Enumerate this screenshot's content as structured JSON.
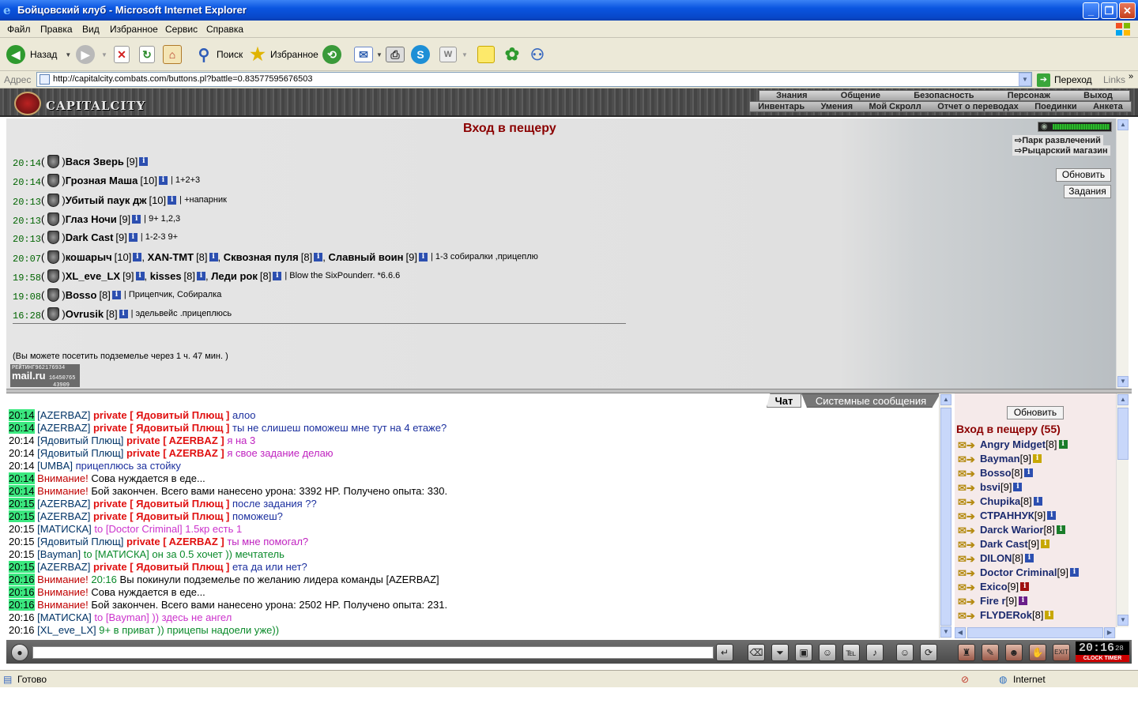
{
  "window": {
    "title": "Бойцовский клуб - Microsoft Internet Explorer",
    "minimize": "_",
    "maximize": "❐",
    "close": "✕"
  },
  "menu": [
    "Файл",
    "Правка",
    "Вид",
    "Избранное",
    "Сервис",
    "Справка"
  ],
  "toolbar": {
    "back": "Назад",
    "search": "Поиск",
    "favorites": "Избранное"
  },
  "address": {
    "label": "Адрес",
    "url": "http://capitalcity.combats.com/buttons.pl?battle=0.83577595676503",
    "go": "Переход",
    "links": "Links"
  },
  "game": {
    "logo": "CAPITALCITY",
    "nav_top": [
      "Знания",
      "Общение",
      "Безопасность",
      "Персонаж",
      "Выход"
    ],
    "nav_bottom": [
      "Инвентарь",
      "Умения",
      "Мой Скролл",
      "Отчет о переводах",
      "Поединки",
      "Анкета"
    ]
  },
  "cave": {
    "title": "Вход в пещеру",
    "rows": [
      {
        "time": "20:14",
        "members": [
          {
            "nick": "Вася Зверь",
            "level": "[9]"
          }
        ],
        "note": ""
      },
      {
        "time": "20:14",
        "members": [
          {
            "nick": "Грозная Маша",
            "level": "[10]"
          }
        ],
        "note": "| 1+2+3"
      },
      {
        "time": "20:13",
        "members": [
          {
            "nick": "Убитый паук дж",
            "level": "[10]"
          }
        ],
        "note": "| +напарник"
      },
      {
        "time": "20:13",
        "members": [
          {
            "nick": "Глаз Ночи",
            "level": "[9]"
          }
        ],
        "note": "| 9+ 1,2,3"
      },
      {
        "time": "20:13",
        "members": [
          {
            "nick": "Dark Cast",
            "level": "[9]"
          }
        ],
        "note": "| 1-2-3 9+"
      },
      {
        "time": "20:07",
        "members": [
          {
            "nick": "кошарыч",
            "level": "[10]"
          },
          {
            "nick": "XAN-TMT",
            "level": "[8]"
          },
          {
            "nick": "Сквозная пуля",
            "level": "[8]"
          },
          {
            "nick": "Славный воин",
            "level": "[9]"
          }
        ],
        "note": "| 1-3 собиралки ,прицеплю"
      },
      {
        "time": "19:58",
        "members": [
          {
            "nick": "XL_eve_LX",
            "level": "[9]"
          },
          {
            "nick": "kisses",
            "level": "[8]"
          },
          {
            "nick": "Леди рок",
            "level": "[8]"
          }
        ],
        "note": "| Blow the SixPounderr. *6.6.6"
      },
      {
        "time": "19:08",
        "members": [
          {
            "nick": "Bosso",
            "level": "[8]"
          }
        ],
        "note": "| Прицепчик, Собиралка"
      },
      {
        "time": "16:28",
        "members": [
          {
            "nick": "Ovrusik",
            "level": "[8]"
          }
        ],
        "note": "| эдельвейс .прицеплюсь"
      }
    ],
    "message": "(Вы можете посетить подземелье через 1 ч. 47 мин. )",
    "counter": {
      "label": "РЕЙТИНГ",
      "v1": "962176934",
      "v2": "16450765",
      "v3": "43909",
      "brand": "mail.ru"
    },
    "links": [
      "Парк развлечений",
      "Рыцарский магазин"
    ],
    "refresh": "Обновить",
    "tasks": "Задания"
  },
  "chat": {
    "tabs": [
      "Чат",
      "Системные сообщения"
    ],
    "lines": [
      {
        "time": "20:14",
        "hl": true,
        "parts": [
          {
            "c": "nk",
            "t": "[AZERBAZ]"
          },
          {
            "c": "priv",
            "t": "private [ Ядовитый Плющ ]"
          },
          {
            "c": "mblue",
            "t": "алоо"
          }
        ]
      },
      {
        "time": "20:14",
        "hl": true,
        "parts": [
          {
            "c": "nk",
            "t": "[AZERBAZ]"
          },
          {
            "c": "priv",
            "t": "private [ Ядовитый Плющ ]"
          },
          {
            "c": "mblue",
            "t": "ты не слишеш поможеш мне тут на 4 етаже?"
          }
        ]
      },
      {
        "time": "20:14",
        "hl": false,
        "parts": [
          {
            "c": "nk",
            "t": "[Ядовитый Плющ]"
          },
          {
            "c": "priv",
            "t": "private [ AZERBAZ ]"
          },
          {
            "c": "mpurple",
            "t": "я на 3"
          }
        ]
      },
      {
        "time": "20:14",
        "hl": false,
        "parts": [
          {
            "c": "nk",
            "t": "[Ядовитый Плющ]"
          },
          {
            "c": "priv",
            "t": "private [ AZERBAZ ]"
          },
          {
            "c": "mpurple",
            "t": "я свое задание делаю"
          }
        ]
      },
      {
        "time": "20:14",
        "hl": false,
        "parts": [
          {
            "c": "nk",
            "t": "[UMBA]"
          },
          {
            "c": "mblue",
            "t": "прицеплюсь за стойку"
          }
        ]
      },
      {
        "time": "20:14",
        "hl": true,
        "parts": [
          {
            "c": "warn",
            "t": "Внимание!"
          },
          {
            "c": "mblack",
            "t": "Сова нуждается в еде..."
          }
        ]
      },
      {
        "time": "20:14",
        "hl": true,
        "parts": [
          {
            "c": "warn",
            "t": "Внимание!"
          },
          {
            "c": "mblack",
            "t": "Бой закончен. Всего вами нанесено урона: 3392 HP. Получено опыта: 330."
          }
        ]
      },
      {
        "time": "20:15",
        "hl": true,
        "parts": [
          {
            "c": "nk",
            "t": "[AZERBAZ]"
          },
          {
            "c": "priv",
            "t": "private [ Ядовитый Плющ ]"
          },
          {
            "c": "mblue",
            "t": "после задания ??"
          }
        ]
      },
      {
        "time": "20:15",
        "hl": true,
        "parts": [
          {
            "c": "nk",
            "t": "[AZERBAZ]"
          },
          {
            "c": "priv",
            "t": "private [ Ядовитый Плющ ]"
          },
          {
            "c": "mblue",
            "t": "поможеш?"
          }
        ]
      },
      {
        "time": "20:15",
        "hl": false,
        "parts": [
          {
            "c": "nk",
            "t": "[МАТИСКА]"
          },
          {
            "c": "magenta",
            "t": "to [Doctor Criminal] 1.5кр есть 1"
          }
        ]
      },
      {
        "time": "20:15",
        "hl": false,
        "parts": [
          {
            "c": "nk",
            "t": "[Ядовитый Плющ]"
          },
          {
            "c": "priv",
            "t": "private [ AZERBAZ ]"
          },
          {
            "c": "mpurple",
            "t": "ты мне помогал?"
          }
        ]
      },
      {
        "time": "20:15",
        "hl": false,
        "parts": [
          {
            "c": "nk",
            "t": "[Bayman]"
          },
          {
            "c": "mgreen",
            "t": "to [МАТИСКА] он за 0.5 хочет )) мечтатель"
          }
        ]
      },
      {
        "time": "20:15",
        "hl": true,
        "parts": [
          {
            "c": "nk",
            "t": "[AZERBAZ]"
          },
          {
            "c": "priv",
            "t": "private [ Ядовитый Плющ ]"
          },
          {
            "c": "mblue",
            "t": "ета да или нет?"
          }
        ]
      },
      {
        "time": "20:16",
        "hl": true,
        "parts": [
          {
            "c": "warn",
            "t": "Внимание!"
          },
          {
            "c": "mgreen",
            "t": "20:16"
          },
          {
            "c": "mblack",
            "t": "Вы покинули подземелье по желанию лидера команды [AZERBAZ]"
          }
        ]
      },
      {
        "time": "20:16",
        "hl": true,
        "parts": [
          {
            "c": "warn",
            "t": "Внимание!"
          },
          {
            "c": "mblack",
            "t": "Сова нуждается в еде..."
          }
        ]
      },
      {
        "time": "20:16",
        "hl": true,
        "parts": [
          {
            "c": "warn",
            "t": "Внимание!"
          },
          {
            "c": "mblack",
            "t": "Бой закончен. Всего вами нанесено урона: 2502 HP. Получено опыта: 231."
          }
        ]
      },
      {
        "time": "20:16",
        "hl": false,
        "parts": [
          {
            "c": "nk",
            "t": "[МАТИСКА]"
          },
          {
            "c": "magenta",
            "t": "to [Bayman] )) здесь не ангел"
          }
        ]
      },
      {
        "time": "20:16",
        "hl": false,
        "parts": [
          {
            "c": "nk",
            "t": "[XL_eve_LX]"
          },
          {
            "c": "mgreen",
            "t": "9+ в приват )) прицепы надоели уже))"
          }
        ]
      }
    ]
  },
  "userlist": {
    "refresh": "Обновить",
    "title": "Вход в пещеру (55)",
    "users": [
      {
        "nick": "Angry Midget",
        "level": "[8]",
        "info": "g"
      },
      {
        "nick": "Bayman",
        "level": "[9]",
        "info": "y"
      },
      {
        "nick": "Bosso",
        "level": "[8]",
        "info": ""
      },
      {
        "nick": "bsvi",
        "level": "[9]",
        "info": ""
      },
      {
        "nick": "Chupika",
        "level": "[8]",
        "info": ""
      },
      {
        "nick": "СТРАННУК",
        "level": "[9]",
        "info": ""
      },
      {
        "nick": "Darck Warior",
        "level": "[8]",
        "info": "g"
      },
      {
        "nick": "Dark Cast",
        "level": "[9]",
        "info": "y"
      },
      {
        "nick": "DILON",
        "level": "[8]",
        "info": ""
      },
      {
        "nick": "Doctor Criminal",
        "level": "[9]",
        "info": ""
      },
      {
        "nick": "Exico",
        "level": "[9]",
        "info": "r"
      },
      {
        "nick": "Fire r",
        "level": "[9]",
        "info": "p"
      },
      {
        "nick": "FLYDERok",
        "level": "[8]",
        "info": "y"
      }
    ]
  },
  "clock": {
    "time": "20:16",
    "seconds": "28",
    "label": "CLOCK TIMER"
  },
  "status": {
    "ready": "Готово",
    "zone": "Internet"
  }
}
